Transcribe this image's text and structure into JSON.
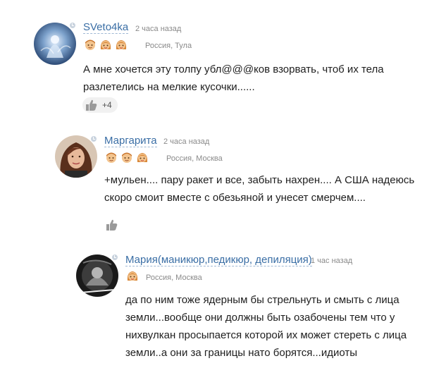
{
  "comments": [
    {
      "author": "SVeto4ka",
      "time": "2 часа назад",
      "location": "Россия, Тула",
      "badges": [
        "boy-face-icon",
        "girl-face-icon",
        "girl-face-icon"
      ],
      "lines": [
        "А мне хочется эту толпу убл@@@ков взорвать, чтоб их тела",
        "разлетелись на мелкие кусочки......"
      ],
      "likes": "+4"
    },
    {
      "author": "Маргарита",
      "time": "2 часа назад",
      "location": "Россия, Москва",
      "badges": [
        "boy-face-icon",
        "boy-face-icon",
        "girl-face-icon"
      ],
      "lines": [
        "+мульен.... пару ракет и все, забыть нахрен.... А США надеюсь",
        "скоро смоит вместе с обезьяной и унесет смерчем...."
      ],
      "likes": ""
    },
    {
      "author": "Мария(маникюр,педикюр, депиляция)",
      "time": "1 час назад",
      "location": "Россия, Москва",
      "badges": [
        "girl-face-icon"
      ],
      "lines": [
        "да по ним тоже ядерным бы стрельнуть и смыть с лица",
        "земли...вообще они должны быть озабочены тем что у",
        "нихвулкан просыпается   которой их может стереть с лица",
        "земли..а они за границы нато борятся...идиоты"
      ],
      "likes": ""
    }
  ]
}
